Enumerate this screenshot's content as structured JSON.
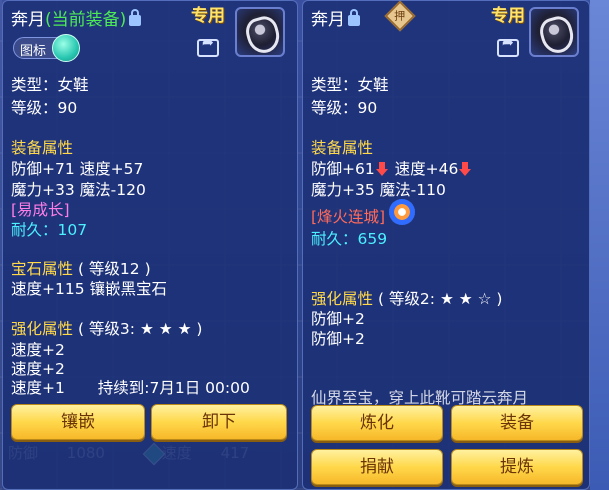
{
  "left": {
    "title": "奔月",
    "title_suffix": "(当前装备)",
    "special": "专用",
    "toggle_label": "图标",
    "type": "类型：女鞋",
    "level": "等级：90",
    "attr_heading": "装备属性",
    "attr_line1": "防御+71 速度+57",
    "attr_line2": "魔力+33 魔法-120",
    "special_attr": "[易成长]",
    "durability": "耐久：107",
    "gem_heading": "宝石属性",
    "gem_level": "( 等级12 )",
    "gem_value": "速度+115 镶嵌黑宝石",
    "enhance_heading": "强化属性",
    "enhance_level": "( 等级3: ★ ★ ★ )",
    "enhance_1": "速度+2",
    "enhance_2": "速度+2",
    "enhance_3": "速度+1",
    "duration": "持续到:7月1日 00:00",
    "btn_inlay": "镶嵌",
    "btn_unequip": "卸下",
    "footer_left": "防御",
    "footer_left_val": "1080",
    "footer_right": "速度",
    "footer_right_val": "417"
  },
  "right": {
    "title": "奔月",
    "seal_char": "押",
    "special": "专用",
    "type": "类型：女鞋",
    "level": "等级：90",
    "attr_heading": "装备属性",
    "attr_line1a": "防御+61",
    "attr_line1b": "速度+46",
    "attr_line2": "魔力+35 魔法-110",
    "special_attr": "[烽火连城]",
    "durability": "耐久：659",
    "enhance_heading": "强化属性",
    "enhance_level": "( 等级2: ★ ★ ☆ )",
    "enhance_1": "防御+2",
    "enhance_2": "防御+2",
    "description": "仙界至宝，穿上此靴可踏云奔月",
    "btn_refine": "炼化",
    "btn_equip": "装备",
    "btn_donate": "捐献",
    "btn_extract": "提炼"
  },
  "colors": {
    "panel": "#1c3076",
    "heading": "#ffd94a",
    "current_tag": "#4dea57",
    "special_attr_left": "#ff7de6",
    "special_attr_right": "#ff6a5a",
    "durability": "#4cf0ff",
    "button": "#ffd84a"
  },
  "icons": [
    "lock-icon",
    "equipment-boots-icon",
    "share-icon",
    "seal-icon",
    "down-arrow-icon",
    "swirl-icon",
    "diamond-icon"
  ]
}
